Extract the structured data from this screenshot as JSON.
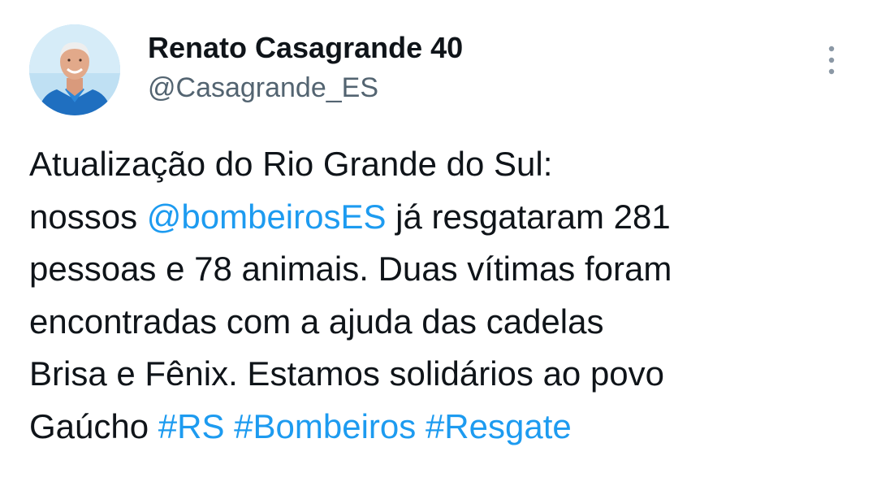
{
  "author": {
    "display_name": "Renato Casagrande 40",
    "handle": "@Casagrande_ES",
    "avatar_icon": "profile-photo"
  },
  "menu": {
    "icon": "more-vertical-icon"
  },
  "tweet": {
    "line1": "Atualização do Rio Grande do Sul:",
    "line2_pre": "nossos ",
    "mention": "@bombeirosES",
    "line2_post": " já resgataram 281",
    "line3": "pessoas e 78 animais. Duas vítimas foram",
    "line4": "encontradas com a ajuda das cadelas",
    "line5": "Brisa e Fênix. Estamos solidários ao povo",
    "line6_pre": "Gaúcho ",
    "hashtags": [
      "#RS",
      "#Bombeiros",
      "#Resgate"
    ]
  },
  "colors": {
    "text": "#0f1419",
    "secondary": "#536471",
    "link": "#1d9bf0",
    "background": "#ffffff"
  }
}
